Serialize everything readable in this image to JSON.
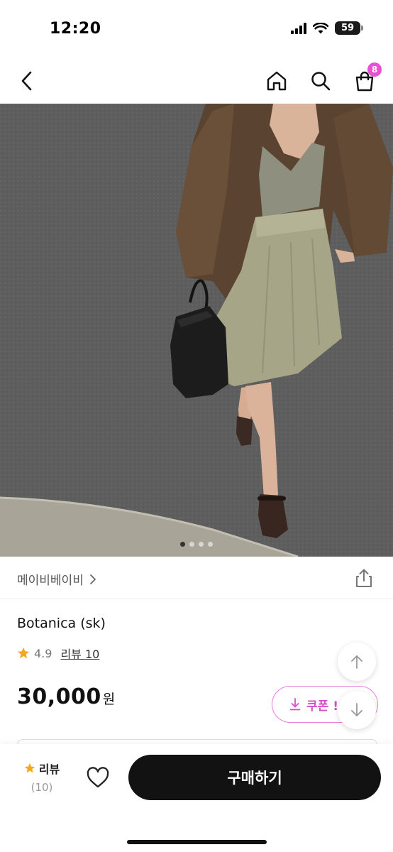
{
  "status_bar": {
    "time": "12:20",
    "battery": "59"
  },
  "nav": {
    "cart_badge": "8"
  },
  "gallery": {
    "page_count": 4,
    "active_page": 1
  },
  "seller": {
    "name": "메이비베이비"
  },
  "product": {
    "name": "Botanica (sk)",
    "rating": "4.9",
    "review_link": "리뷰 10",
    "price": "30,000",
    "currency": "원"
  },
  "coupon": {
    "label": "쿠폰 !"
  },
  "bottom_bar": {
    "review_label": "리뷰",
    "review_count": "(10)",
    "buy_label": "구매하기"
  },
  "colors": {
    "accent": "#e84fd2",
    "star": "#f5a623",
    "buy_button": "#121212"
  }
}
